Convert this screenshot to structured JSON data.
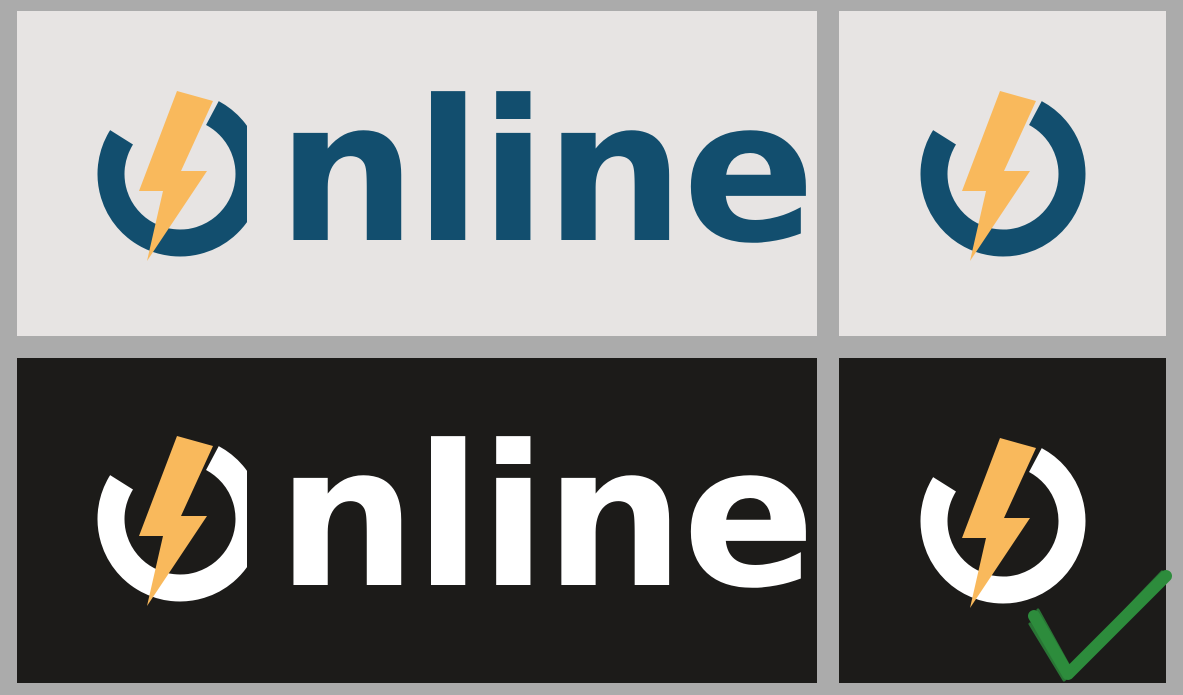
{
  "logo": {
    "wordmark_rest": "nline",
    "icon": "power-bolt-icon"
  },
  "colors": {
    "navy": "#124e6e",
    "orange": "#f9b95c",
    "light_bg": "#e7e4e3",
    "dark_bg": "#1c1b19",
    "white": "#ffffff",
    "check": "#2d8c3c"
  },
  "approval_icon": "checkmark-icon"
}
